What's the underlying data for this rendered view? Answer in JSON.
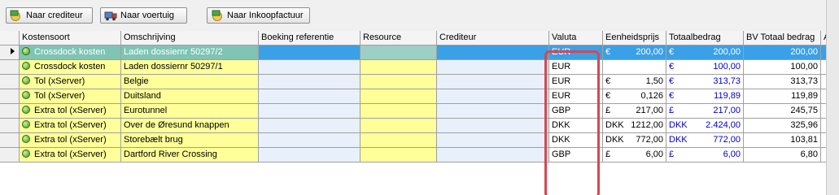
{
  "toolbar": {
    "btn_crediteur": "Naar crediteur",
    "btn_voertuig": "Naar voertuig",
    "btn_inkoopfactuur": "Naar Inkoopfactuur"
  },
  "columns": [
    "Kostensoort",
    "Omschrijving",
    "Boeking referentie",
    "Resource",
    "Crediteur",
    "Valuta",
    "Eenheidsprijs",
    "Totaalbedrag",
    "BV Totaal bedrag",
    "Alle"
  ],
  "rows": [
    {
      "kostensoort": "Crossdock kosten",
      "omschrijving": "Laden dossiernr 50297/2",
      "boeking": "",
      "resource": "",
      "crediteur": "",
      "valuta": "EUR",
      "ep_cur": "€",
      "ep_val": "200,00",
      "tb_cur": "€",
      "tb_val": "200,00",
      "bv": "200,00"
    },
    {
      "kostensoort": "Crossdock kosten",
      "omschrijving": "Laden dossiernr 50297/1",
      "boeking": "",
      "resource": "",
      "crediteur": "",
      "valuta": "EUR",
      "ep_cur": "",
      "ep_val": "",
      "tb_cur": "€",
      "tb_val": "100,00",
      "bv": "100,00"
    },
    {
      "kostensoort": "Tol (xServer)",
      "omschrijving": "Belgie",
      "boeking": "",
      "resource": "",
      "crediteur": "",
      "valuta": "EUR",
      "ep_cur": "€",
      "ep_val": "1,50",
      "tb_cur": "€",
      "tb_val": "313,73",
      "bv": "313,73"
    },
    {
      "kostensoort": "Tol (xServer)",
      "omschrijving": "Duitsland",
      "boeking": "",
      "resource": "",
      "crediteur": "",
      "valuta": "EUR",
      "ep_cur": "€",
      "ep_val": "0,126",
      "tb_cur": "€",
      "tb_val": "119,89",
      "bv": "119,89"
    },
    {
      "kostensoort": "Extra tol (xServer)",
      "omschrijving": "Eurotunnel",
      "boeking": "",
      "resource": "",
      "crediteur": "",
      "valuta": "GBP",
      "ep_cur": "£",
      "ep_val": "217,00",
      "tb_cur": "£",
      "tb_val": "217,00",
      "bv": "245,75"
    },
    {
      "kostensoort": "Extra tol (xServer)",
      "omschrijving": "Over de Øresund knappen",
      "boeking": "",
      "resource": "",
      "crediteur": "",
      "valuta": "DKK",
      "ep_cur": "DKK",
      "ep_val": "1212,00",
      "tb_cur": "DKK",
      "tb_val": "2.424,00",
      "bv": "325,96"
    },
    {
      "kostensoort": "Extra tol (xServer)",
      "omschrijving": "Storebælt brug",
      "boeking": "",
      "resource": "",
      "crediteur": "",
      "valuta": "DKK",
      "ep_cur": "DKK",
      "ep_val": "772,00",
      "tb_cur": "DKK",
      "tb_val": "772,00",
      "bv": "103,81"
    },
    {
      "kostensoort": "Extra tol (xServer)",
      "omschrijving": "Dartford River Crossing",
      "boeking": "",
      "resource": "",
      "crediteur": "",
      "valuta": "GBP",
      "ep_cur": "£",
      "ep_val": "6,00",
      "tb_cur": "£",
      "tb_val": "6,00",
      "bv": "6,80"
    }
  ],
  "colors": {
    "highlight": "#d8474f",
    "selected": "#3aa0e8",
    "yellow": "#ffff99"
  }
}
